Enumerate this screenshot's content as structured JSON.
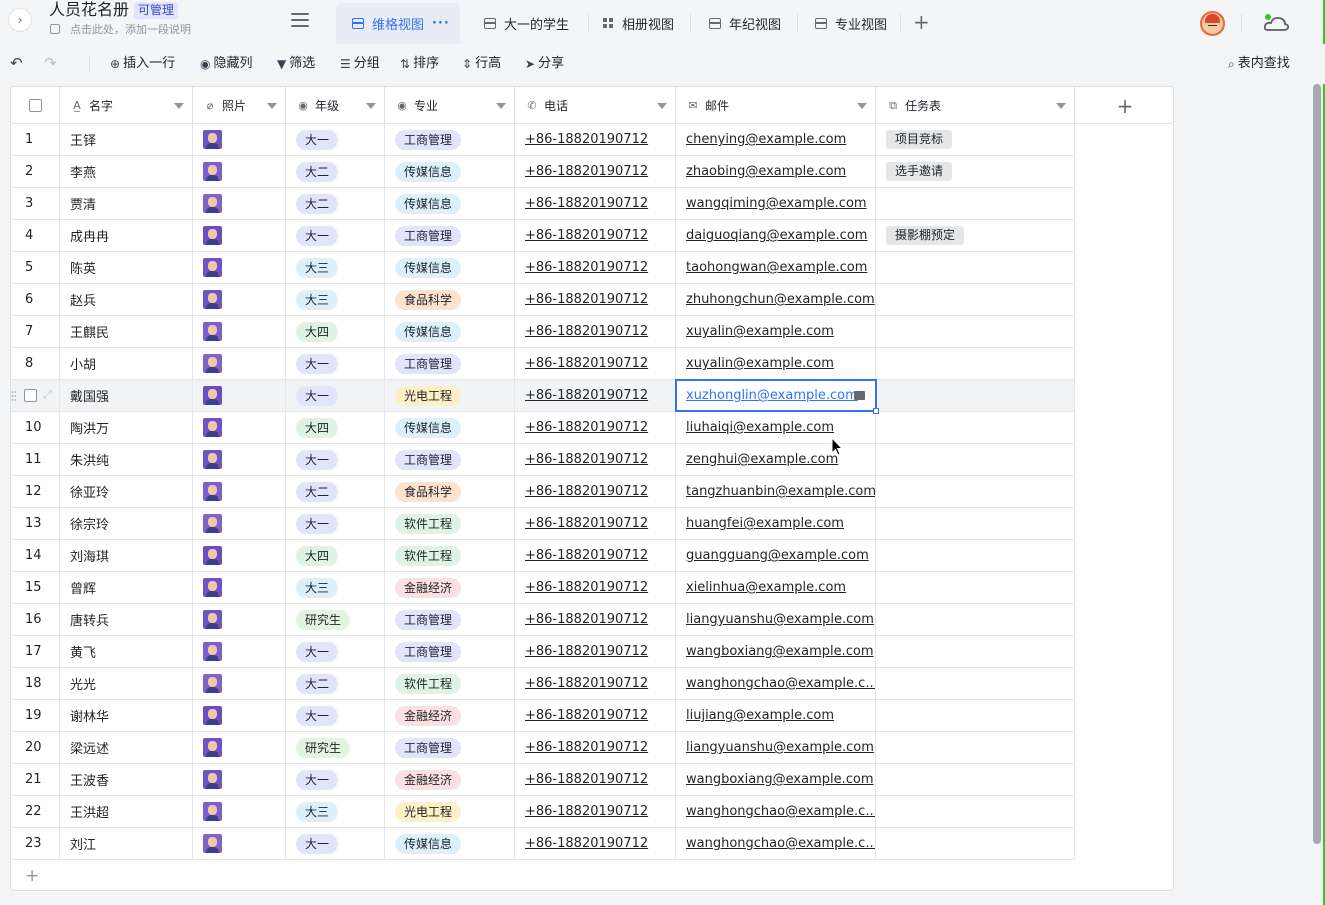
{
  "header": {
    "title": "人员花名册",
    "role_tag": "可管理",
    "description_placeholder": "点击此处，添加一段说明"
  },
  "tabs": [
    {
      "label": "维格视图",
      "active": true,
      "icon": "grid-view-icon"
    },
    {
      "label": "大一的学生",
      "active": false,
      "icon": "grid-view-icon"
    },
    {
      "label": "相册视图",
      "active": false,
      "icon": "gallery-view-icon"
    },
    {
      "label": "年纪视图",
      "active": false,
      "icon": "grid-view-icon"
    },
    {
      "label": "专业视图",
      "active": false,
      "icon": "grid-view-icon"
    }
  ],
  "toolbar": {
    "insert_row": "插入一行",
    "hide_cols": "隐藏列",
    "filter": "筛选",
    "group": "分组",
    "sort": "排序",
    "row_height": "行高",
    "share": "分享",
    "search": "表内查找"
  },
  "columns": [
    {
      "label": "名字",
      "icon": "text-field-icon"
    },
    {
      "label": "照片",
      "icon": "attachment-icon"
    },
    {
      "label": "年级",
      "icon": "single-select-icon"
    },
    {
      "label": "专业",
      "icon": "single-select-icon"
    },
    {
      "label": "电话",
      "icon": "phone-icon"
    },
    {
      "label": "邮件",
      "icon": "mail-icon"
    },
    {
      "label": "任务表",
      "icon": "link-icon"
    }
  ],
  "colors": {
    "accent": "#3370ff",
    "grade": {
      "大一": "#e1e4fb",
      "大二": "#dfe6fb",
      "大三": "#dcf0fa",
      "大四": "#dff3e4",
      "研究生": "#e2f5df"
    },
    "major": {
      "工商管理": "#e1e4fb",
      "传媒信息": "#dcf0fa",
      "食品科学": "#fde2d0",
      "光电工程": "#fdf0c7",
      "软件工程": "#dff3e4",
      "金融经济": "#fbe0e3"
    }
  },
  "rows": [
    {
      "num": "1",
      "name": "王铎",
      "grade": "大一",
      "major": "工商管理",
      "phone": "+86-18820190712",
      "email": "chenying@example.com",
      "task": "项目竞标"
    },
    {
      "num": "2",
      "name": "李燕",
      "grade": "大二",
      "major": "传媒信息",
      "phone": "+86-18820190712",
      "email": "zhaobing@example.com",
      "task": "选手邀请"
    },
    {
      "num": "3",
      "name": "贾清",
      "grade": "大二",
      "major": "传媒信息",
      "phone": "+86-18820190712",
      "email": "wangqiming@example.com",
      "task": ""
    },
    {
      "num": "4",
      "name": "成冉冉",
      "grade": "大一",
      "major": "工商管理",
      "phone": "+86-18820190712",
      "email": "daiguoqiang@example.com",
      "task": "摄影棚预定"
    },
    {
      "num": "5",
      "name": "陈英",
      "grade": "大三",
      "major": "传媒信息",
      "phone": "+86-18820190712",
      "email": "taohongwan@example.com",
      "task": ""
    },
    {
      "num": "6",
      "name": "赵兵",
      "grade": "大三",
      "major": "食品科学",
      "phone": "+86-18820190712",
      "email": "zhuhongchun@example.com",
      "task": ""
    },
    {
      "num": "7",
      "name": "王麒民",
      "grade": "大四",
      "major": "传媒信息",
      "phone": "+86-18820190712",
      "email": "xuyalin@example.com",
      "task": ""
    },
    {
      "num": "8",
      "name": "小胡",
      "grade": "大一",
      "major": "工商管理",
      "phone": "+86-18820190712",
      "email": "xuyalin@example.com",
      "task": ""
    },
    {
      "num": "",
      "name": "戴国强",
      "grade": "大一",
      "major": "光电工程",
      "phone": "+86-18820190712",
      "email": "xuzhonglin@example.com",
      "task": ""
    },
    {
      "num": "10",
      "name": "陶洪万",
      "grade": "大四",
      "major": "传媒信息",
      "phone": "+86-18820190712",
      "email": "liuhaiqi@example.com",
      "task": ""
    },
    {
      "num": "11",
      "name": "朱洪纯",
      "grade": "大一",
      "major": "工商管理",
      "phone": "+86-18820190712",
      "email": "zenghui@example.com",
      "task": ""
    },
    {
      "num": "12",
      "name": "徐亚玲",
      "grade": "大二",
      "major": "食品科学",
      "phone": "+86-18820190712",
      "email": "tangzhuanbin@example.com",
      "task": ""
    },
    {
      "num": "13",
      "name": "徐宗玲",
      "grade": "大一",
      "major": "软件工程",
      "phone": "+86-18820190712",
      "email": "huangfei@example.com",
      "task": ""
    },
    {
      "num": "14",
      "name": "刘海琪",
      "grade": "大四",
      "major": "软件工程",
      "phone": "+86-18820190712",
      "email": "guangguang@example.com",
      "task": ""
    },
    {
      "num": "15",
      "name": "曾辉",
      "grade": "大三",
      "major": "金融经济",
      "phone": "+86-18820190712",
      "email": "xielinhua@example.com",
      "task": ""
    },
    {
      "num": "16",
      "name": "唐转兵",
      "grade": "研究生",
      "major": "工商管理",
      "phone": "+86-18820190712",
      "email": "liangyuanshu@example.com",
      "task": ""
    },
    {
      "num": "17",
      "name": "黄飞",
      "grade": "大一",
      "major": "工商管理",
      "phone": "+86-18820190712",
      "email": "wangboxiang@example.com",
      "task": ""
    },
    {
      "num": "18",
      "name": "光光",
      "grade": "大二",
      "major": "软件工程",
      "phone": "+86-18820190712",
      "email": "wanghongchao@example.c...",
      "task": ""
    },
    {
      "num": "19",
      "name": "谢林华",
      "grade": "大一",
      "major": "金融经济",
      "phone": "+86-18820190712",
      "email": "liujiang@example.com",
      "task": ""
    },
    {
      "num": "20",
      "name": "梁远述",
      "grade": "研究生",
      "major": "工商管理",
      "phone": "+86-18820190712",
      "email": "liangyuanshu@example.com",
      "task": ""
    },
    {
      "num": "21",
      "name": "王波香",
      "grade": "大一",
      "major": "金融经济",
      "phone": "+86-18820190712",
      "email": "wangboxiang@example.com",
      "task": ""
    },
    {
      "num": "22",
      "name": "王洪超",
      "grade": "大三",
      "major": "光电工程",
      "phone": "+86-18820190712",
      "email": "wanghongchao@example.c...",
      "task": ""
    },
    {
      "num": "23",
      "name": "刘江",
      "grade": "大一",
      "major": "传媒信息",
      "phone": "+86-18820190712",
      "email": "wanghongchao@example.c...",
      "task": ""
    }
  ],
  "selected_row": 8,
  "add_row_symbol": "+",
  "add_col_symbol": "+"
}
